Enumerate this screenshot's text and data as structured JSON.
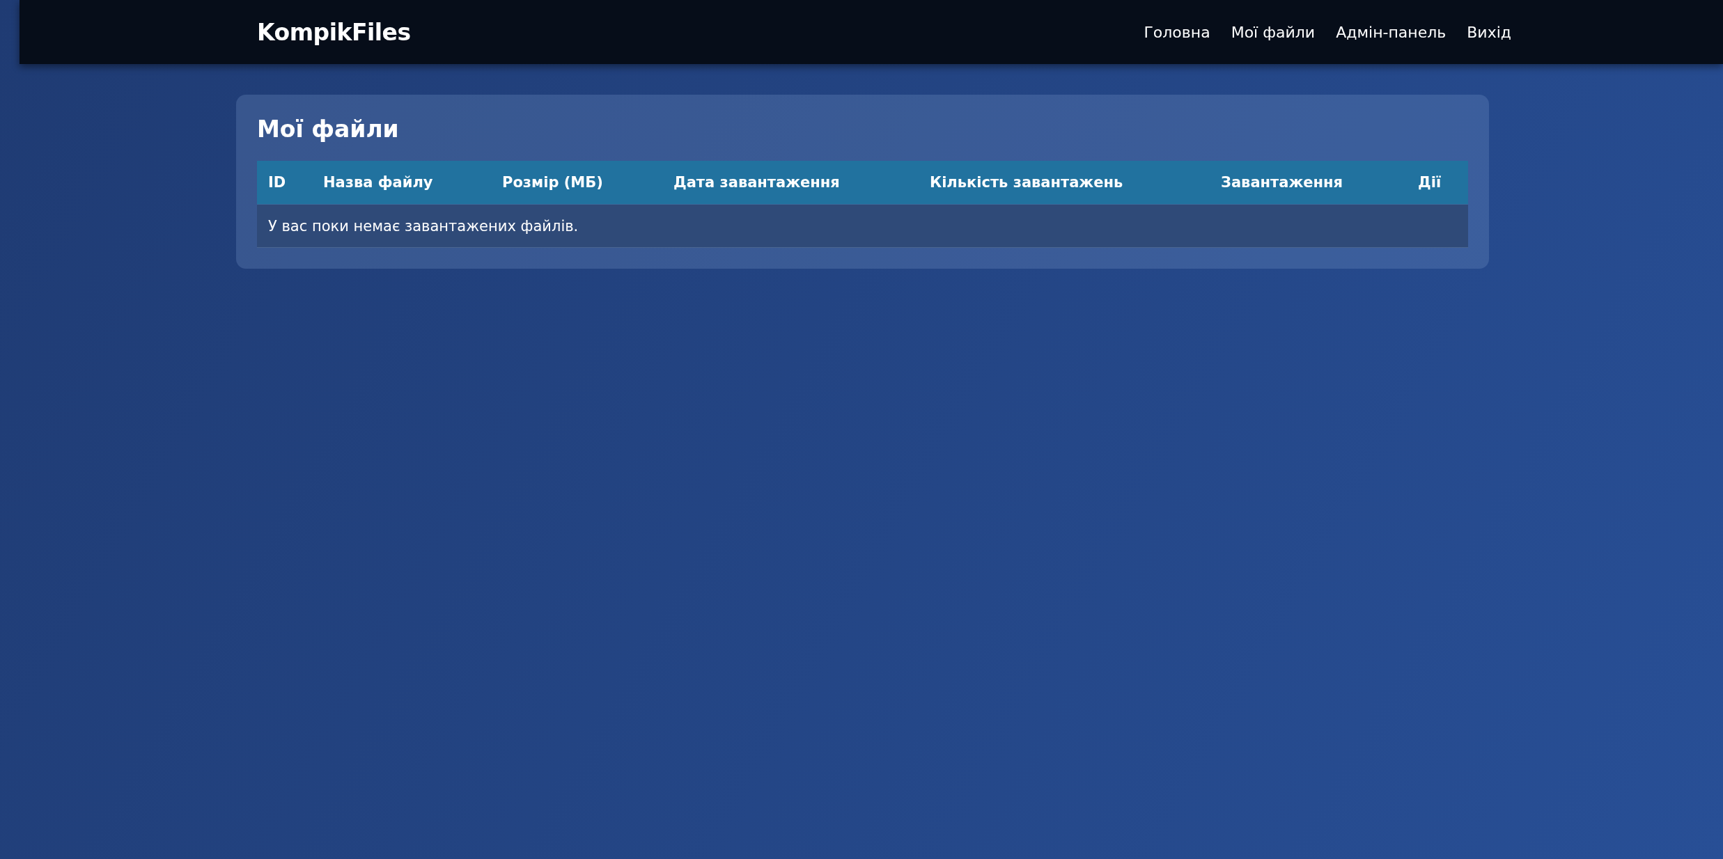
{
  "header": {
    "logo": "KompikFiles",
    "nav": [
      {
        "label": "Головна"
      },
      {
        "label": "Мої файли"
      },
      {
        "label": "Адмін-панель"
      },
      {
        "label": "Вихід"
      }
    ]
  },
  "page": {
    "title": "Мої файли"
  },
  "table": {
    "columns": [
      "ID",
      "Назва файлу",
      "Розмір (МБ)",
      "Дата завантаження",
      "Кількість завантажень",
      "Завантаження",
      "Дії"
    ],
    "empty_message": "У вас поки немає завантажених файлів."
  }
}
